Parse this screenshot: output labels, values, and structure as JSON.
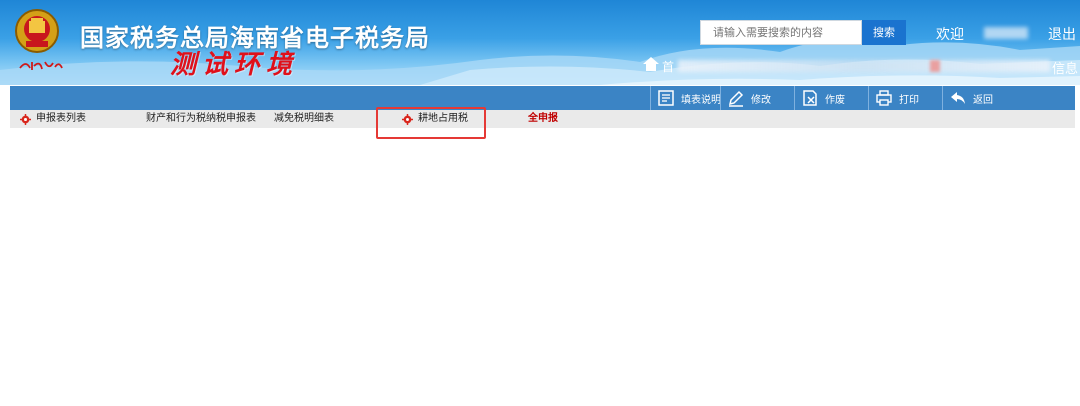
{
  "header": {
    "site_title": "国家税务总局海南省电子税务局",
    "test_env_label": "测试环境",
    "search_placeholder": "请输入需要搜索的内容",
    "search_button": "搜索",
    "welcome": "欢迎",
    "logout": "退出",
    "home_label": "首",
    "msg_label": "信息"
  },
  "toolbar": {
    "buttons": [
      {
        "label": "填表说明",
        "icon": "document-icon"
      },
      {
        "label": "修改",
        "icon": "pencil-icon"
      },
      {
        "label": "作废",
        "icon": "void-doc-icon"
      },
      {
        "label": "打印",
        "icon": "printer-icon"
      },
      {
        "label": "返回",
        "icon": "back-arrow-icon"
      }
    ]
  },
  "tabs": [
    {
      "label": "申报表列表",
      "icon": "gear-icon"
    },
    {
      "label": "财产和行为税纳税申报表"
    },
    {
      "label": "减免税明细表"
    },
    {
      "label": "耕地占用税",
      "icon": "gear-icon",
      "highlighted": true
    },
    {
      "label": "全申报"
    }
  ],
  "colors": {
    "header_blue": "#1f86d6",
    "toolbar_blue": "#3b84c5",
    "test_env_red": "#e0101a",
    "highlight_red": "#e53935",
    "tab_all_red": "#c00000"
  }
}
